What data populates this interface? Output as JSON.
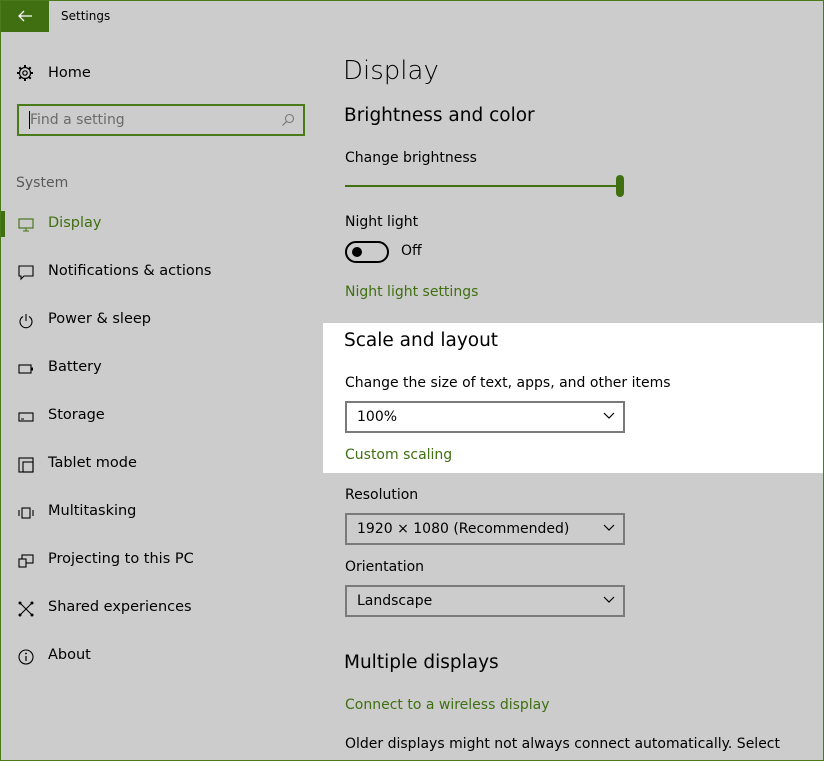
{
  "window": {
    "title": "Settings"
  },
  "sidebar": {
    "home": "Home",
    "search_placeholder": "Find a setting",
    "section": "System",
    "items": [
      {
        "label": "Display",
        "icon": "monitor-icon",
        "active": true
      },
      {
        "label": "Notifications & actions",
        "icon": "notification-icon"
      },
      {
        "label": "Power & sleep",
        "icon": "power-icon"
      },
      {
        "label": "Battery",
        "icon": "battery-icon"
      },
      {
        "label": "Storage",
        "icon": "storage-icon"
      },
      {
        "label": "Tablet mode",
        "icon": "tablet-icon"
      },
      {
        "label": "Multitasking",
        "icon": "multitasking-icon"
      },
      {
        "label": "Projecting to this PC",
        "icon": "projector-icon"
      },
      {
        "label": "Shared experiences",
        "icon": "shared-icon"
      },
      {
        "label": "About",
        "icon": "info-icon"
      }
    ]
  },
  "main": {
    "title": "Display",
    "brightness_color": {
      "heading": "Brightness and color",
      "brightness_label": "Change brightness",
      "brightness_value": 1.0,
      "night_light_label": "Night light",
      "night_light_state": "Off",
      "night_light_link": "Night light settings"
    },
    "scale_layout": {
      "heading": "Scale and layout",
      "size_label": "Change the size of text, apps, and other items",
      "size_value": "100%",
      "custom_link": "Custom scaling",
      "resolution_label": "Resolution",
      "resolution_value": "1920 × 1080 (Recommended)",
      "orientation_label": "Orientation",
      "orientation_value": "Landscape"
    },
    "multiple_displays": {
      "heading": "Multiple displays",
      "wireless_link": "Connect to a wireless display",
      "note": "Older displays might not always connect automatically. Select"
    }
  },
  "colors": {
    "accent": "#3f6f10",
    "background": "#cccccc",
    "highlight": "#ffffff"
  }
}
